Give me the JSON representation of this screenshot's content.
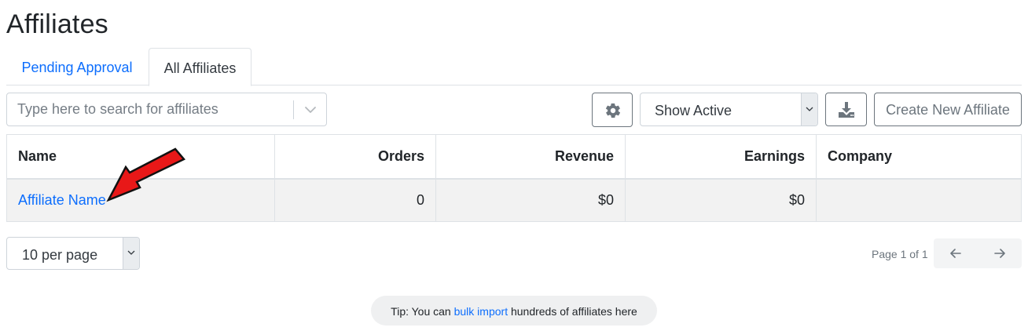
{
  "page": {
    "title": "Affiliates"
  },
  "tabs": [
    {
      "label": "Pending Approval",
      "active": false
    },
    {
      "label": "All Affiliates",
      "active": true
    }
  ],
  "toolbar": {
    "search_placeholder": "Type here to search for affiliates",
    "status_filter": "Show Active",
    "create_label": "Create New Affiliate",
    "settings_icon": "gear-icon",
    "download_icon": "download-icon"
  },
  "table": {
    "columns": [
      "Name",
      "Orders",
      "Revenue",
      "Earnings",
      "Company"
    ],
    "rows": [
      {
        "name": "Affiliate Name",
        "orders": "0",
        "revenue": "$0",
        "earnings": "$0",
        "company": ""
      }
    ]
  },
  "pagination": {
    "per_page": "10 per page",
    "page_info": "Page 1 of 1"
  },
  "tip": {
    "prefix": "Tip: You can ",
    "link": "bulk import",
    "suffix": " hundreds of affiliates here"
  },
  "colors": {
    "link": "#0d6efd",
    "annotation_arrow": "#e81818",
    "row_bg": "#f2f2f2"
  }
}
